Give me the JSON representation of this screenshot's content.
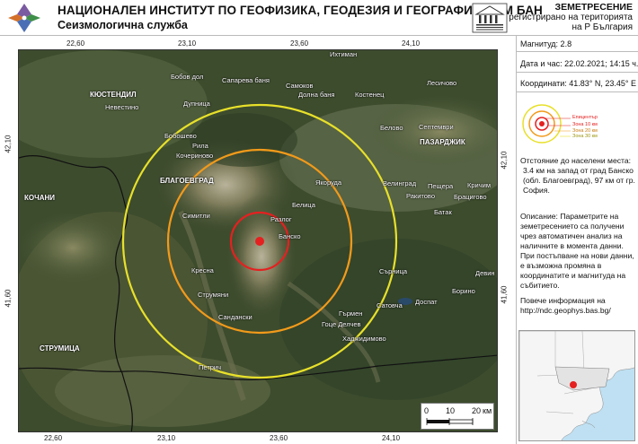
{
  "header": {
    "title": "НАЦИОНАЛЕН ИНСТИТУТ ПО ГЕОФИЗИКА, ГЕОДЕЗИЯ И ГЕОГРАФИЯ КЪМ БАН",
    "subtitle": "Сеизмологична служба",
    "right_line1": "ЗЕМЕТРЕСЕНИЕ",
    "right_line2": "регистрирано на територията",
    "right_line3": "на Р България"
  },
  "map": {
    "ticks_top": [
      "22,60",
      "23,10",
      "23,60",
      "24,10"
    ],
    "ticks_bottom": [
      "22,60",
      "23,10",
      "23,60",
      "24,10"
    ],
    "ticks_left": [
      "42,10",
      "41,60"
    ],
    "ticks_right": [
      "42,10",
      "41,60"
    ],
    "places": [
      {
        "name": "Ихтиман",
        "big": false
      },
      {
        "name": "КЮСТЕНДИЛ",
        "big": true
      },
      {
        "name": "Бобов дол",
        "big": false
      },
      {
        "name": "Сапарева баня",
        "big": false
      },
      {
        "name": "Самоков",
        "big": false
      },
      {
        "name": "Долна баня",
        "big": false
      },
      {
        "name": "Костенец",
        "big": false
      },
      {
        "name": "Лесичово",
        "big": false
      },
      {
        "name": "Невестино",
        "big": false
      },
      {
        "name": "Дупница",
        "big": false
      },
      {
        "name": "Бобошево",
        "big": false
      },
      {
        "name": "Белово",
        "big": false
      },
      {
        "name": "Септември",
        "big": false
      },
      {
        "name": "Рила",
        "big": false
      },
      {
        "name": "ПАЗАРДЖИК",
        "big": true
      },
      {
        "name": "Кочериново",
        "big": false
      },
      {
        "name": "БЛАГОЕВГРАД",
        "big": true
      },
      {
        "name": "Якоруда",
        "big": false
      },
      {
        "name": "Велинград",
        "big": false
      },
      {
        "name": "Пещера",
        "big": false
      },
      {
        "name": "Кричим",
        "big": false
      },
      {
        "name": "КОЧАНИ",
        "big": true
      },
      {
        "name": "Ракитово",
        "big": false
      },
      {
        "name": "Брацигово",
        "big": false
      },
      {
        "name": "Белица",
        "big": false
      },
      {
        "name": "Симитли",
        "big": false
      },
      {
        "name": "Разлог",
        "big": false
      },
      {
        "name": "Батак",
        "big": false
      },
      {
        "name": "Банско",
        "big": false
      },
      {
        "name": "Кресна",
        "big": false
      },
      {
        "name": "Сърница",
        "big": false
      },
      {
        "name": "Девин",
        "big": false
      },
      {
        "name": "Струмяни",
        "big": false
      },
      {
        "name": "Борино",
        "big": false
      },
      {
        "name": "Гърмен",
        "big": false
      },
      {
        "name": "Доспат",
        "big": false
      },
      {
        "name": "Сатовча",
        "big": false
      },
      {
        "name": "Сандански",
        "big": false
      },
      {
        "name": "Гоце Делчев",
        "big": false
      },
      {
        "name": "Хаджидимово",
        "big": false
      },
      {
        "name": "СТРУМИЦА",
        "big": true
      },
      {
        "name": "Петрич",
        "big": false
      }
    ],
    "scale": {
      "zero": "0",
      "ten": "10",
      "twenty": "20",
      "unit": "км"
    },
    "epicenter": {
      "lon": 23.45,
      "lat": 41.83
    }
  },
  "panel": {
    "magnitude": "Магнитуд: 2.8",
    "datetime": "Дата и час: 22.02.2021; 14:15 ч.",
    "coords": "Координати: 41.83° N, 23.45° E",
    "legend": {
      "epicenter": "Епицентър",
      "zone10": "Зона 10 км",
      "zone20": "Зона 20 км",
      "zone30": "Зона 30 км"
    },
    "distance_head": "Отстояние до населени места:",
    "distance_text": "3.4 км на запад от град Банско (обл. Благоевград), 97 км от гр. София.",
    "description": "Описание: Параметрите на земетресението са получени чрез автоматичен анализ на наличните в момента данни. При постъпване на нови данни, е възможна промяна в координатите и магнитуда на събитието.",
    "more_info": "Повече информация на",
    "url": "http://ndc.geophys.bas.bg/"
  },
  "colors": {
    "ring10": "#e52020",
    "ring20": "#f29a1a",
    "ring30": "#e8e02a",
    "epicenter": "#e52020"
  }
}
